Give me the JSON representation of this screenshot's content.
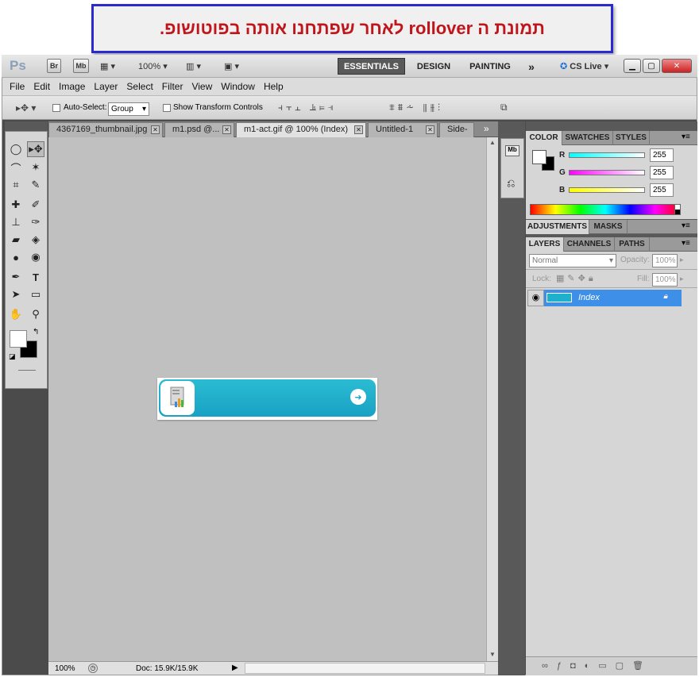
{
  "caption": "תמונת ה rollover לאחר שפתחנו אותה בפוטושופ.",
  "titlebar": {
    "app_logo": "Ps",
    "br": "Br",
    "mb": "Mb",
    "zoom": "100%",
    "workspaces": [
      "ESSENTIALS",
      "DESIGN",
      "PAINTING"
    ],
    "more": "»",
    "cs_live": "CS Live"
  },
  "menu": [
    "File",
    "Edit",
    "Image",
    "Layer",
    "Select",
    "Filter",
    "View",
    "Window",
    "Help"
  ],
  "options": {
    "auto_select_label": "Auto-Select:",
    "auto_select_value": "Group",
    "show_transform": "Show Transform Controls"
  },
  "doc_tabs": [
    "4367169_thumbnail.jpg",
    "m1.psd @...",
    "m1-act.gif @ 100% (Index)",
    "Untitled-1",
    "Side-"
  ],
  "status": {
    "zoom": "100%",
    "doc": "Doc: 15.9K/15.9K"
  },
  "color_panel": {
    "tabs": [
      "COLOR",
      "SWATCHES",
      "STYLES"
    ],
    "channels": [
      {
        "name": "R",
        "value": "255"
      },
      {
        "name": "G",
        "value": "255"
      },
      {
        "name": "B",
        "value": "255"
      }
    ]
  },
  "adjust_panel": {
    "tabs": [
      "ADJUSTMENTS",
      "MASKS"
    ]
  },
  "layers_panel": {
    "tabs": [
      "LAYERS",
      "CHANNELS",
      "PATHS"
    ],
    "blend_mode": "Normal",
    "opacity_label": "Opacity:",
    "opacity_value": "100%",
    "lock_label": "Lock:",
    "fill_label": "Fill:",
    "fill_value": "100%",
    "layer_name": "Index"
  },
  "colors": {
    "caption_text": "#c0161b",
    "caption_border": "#2a2ad0",
    "layer_selected": "#3d8fe7",
    "banner": "#1fb0cb"
  }
}
